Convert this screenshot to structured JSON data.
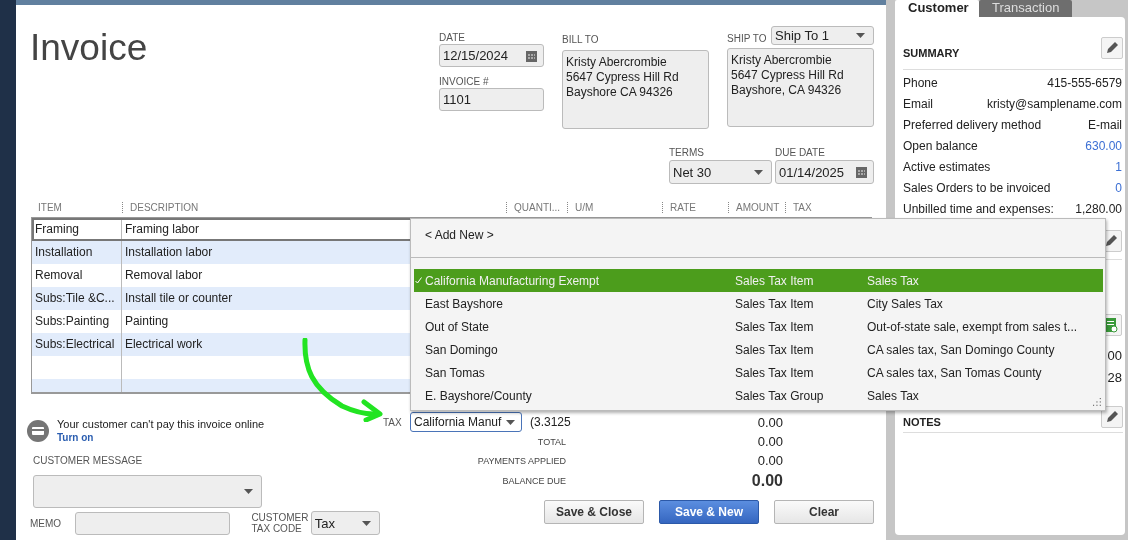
{
  "title": "Invoice",
  "date": {
    "label": "DATE",
    "value": "12/15/2024"
  },
  "invoice_number": {
    "label": "INVOICE #",
    "value": "1101"
  },
  "bill_to": {
    "label": "BILL TO",
    "lines": [
      "Kristy Abercrombie",
      "5647 Cypress Hill Rd",
      "Bayshore CA 94326"
    ]
  },
  "ship_to": {
    "label": "SHIP TO",
    "selector": "Ship To 1",
    "lines": [
      "Kristy Abercrombie",
      "5647 Cypress Hill Rd",
      "Bayshore, CA 94326"
    ]
  },
  "terms": {
    "label": "TERMS",
    "value": "Net 30"
  },
  "due_date": {
    "label": "DUE DATE",
    "value": "01/14/2025"
  },
  "table": {
    "columns": [
      "ITEM",
      "DESCRIPTION",
      "QUANTI...",
      "U/M",
      "RATE",
      "AMOUNT",
      "TAX"
    ],
    "rows": [
      {
        "item": "Framing",
        "description": "Framing labor",
        "selected": true
      },
      {
        "item": "Installation",
        "description": "Installation labor",
        "selected": false
      },
      {
        "item": "Removal",
        "description": "Removal labor",
        "selected": false
      },
      {
        "item": "Subs:Tile &C...",
        "description": "Install tile or counter",
        "selected": false
      },
      {
        "item": "Subs:Painting",
        "description": "Painting",
        "selected": false
      },
      {
        "item": "Subs:Electrical",
        "description": "Electrical work",
        "selected": false
      }
    ]
  },
  "tax_dropdown": {
    "add_new": "< Add New >",
    "options": [
      {
        "name": "California Manufacturing Exempt",
        "type": "Sales Tax Item",
        "description": "Sales Tax",
        "selected": true
      },
      {
        "name": "East Bayshore",
        "type": "Sales Tax Item",
        "description": "City Sales Tax",
        "selected": false
      },
      {
        "name": "Out of State",
        "type": "Sales Tax Item",
        "description": "Out-of-state sale, exempt from sales t...",
        "selected": false
      },
      {
        "name": "San Domingo",
        "type": "Sales Tax Item",
        "description": "CA sales tax, San Domingo County",
        "selected": false
      },
      {
        "name": "San Tomas",
        "type": "Sales Tax Item",
        "description": "CA sales tax, San Tomas County",
        "selected": false
      },
      {
        "name": "E. Bayshore/County",
        "type": "Sales Tax Group",
        "description": "Sales Tax",
        "selected": false
      }
    ]
  },
  "online_payment": {
    "message": "Your customer can't pay this invoice online",
    "link": "Turn on"
  },
  "customer_message": {
    "label": "CUSTOMER MESSAGE"
  },
  "memo": {
    "label": "MEMO"
  },
  "customer_tax_code": {
    "label": "CUSTOMER TAX CODE",
    "value": "Tax"
  },
  "tax": {
    "label": "TAX",
    "value": "California Manuf",
    "rate": "(3.3125",
    "amount": "0.00"
  },
  "totals": [
    {
      "label": "TOTAL",
      "value": "0.00",
      "kind": "normal"
    },
    {
      "label": "PAYMENTS APPLIED",
      "value": "0.00",
      "kind": "normal"
    },
    {
      "label": "BALANCE DUE",
      "value": "0.00",
      "kind": "emphasis"
    }
  ],
  "buttons": [
    {
      "label": "Save & Close",
      "kind": "default"
    },
    {
      "label": "Save & New",
      "kind": "primary"
    },
    {
      "label": "Clear",
      "kind": "default"
    }
  ],
  "side_panel": {
    "tabs": [
      {
        "label": "Customer",
        "selected": true
      },
      {
        "label": "Transaction",
        "selected": false
      }
    ],
    "summary": {
      "title": "SUMMARY",
      "rows": [
        {
          "label": "Phone",
          "value": "415-555-6579",
          "link": false
        },
        {
          "label": "Email",
          "value": "kristy@samplename.com",
          "link": false
        },
        {
          "label": "Preferred delivery method",
          "value": "E-mail",
          "link": false
        },
        {
          "label": "Open balance",
          "value": "630.00",
          "link": true
        },
        {
          "label": "Active estimates",
          "value": "1",
          "link": true
        },
        {
          "label": "Sales Orders to be invoiced",
          "value": "0",
          "link": true
        },
        {
          "label": "Unbilled time and expenses:",
          "value": "1,280.00",
          "link": false
        }
      ]
    },
    "partial_values": [
      "00",
      "28"
    ],
    "notes": {
      "title": "NOTES"
    }
  }
}
